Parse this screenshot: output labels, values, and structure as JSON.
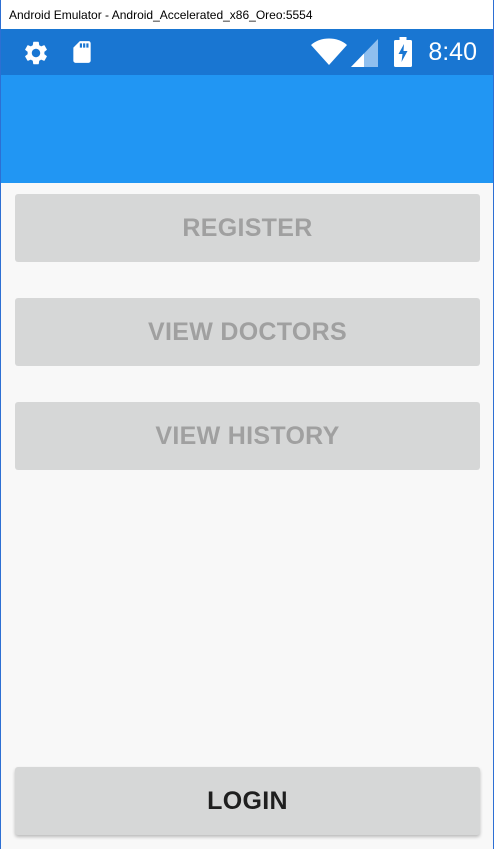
{
  "window": {
    "title": "Android Emulator - Android_Accelerated_x86_Oreo:5554"
  },
  "status_bar": {
    "time": "8:40",
    "icons": [
      "gear-icon",
      "sd-card-icon",
      "wifi-icon",
      "signal-icon",
      "battery-charging-icon"
    ],
    "background_color": "#1976d2"
  },
  "app_bar": {
    "background_color": "#2196f3"
  },
  "main": {
    "buttons": [
      {
        "label": "REGISTER",
        "enabled": false
      },
      {
        "label": "VIEW DOCTORS",
        "enabled": false
      },
      {
        "label": "VIEW HISTORY",
        "enabled": false
      }
    ],
    "login": {
      "label": "LOGIN",
      "enabled": true
    }
  }
}
